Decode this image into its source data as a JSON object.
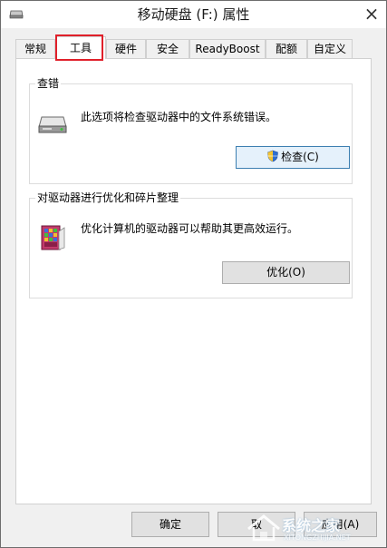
{
  "window": {
    "title": "移动硬盘 (F:) 属性",
    "close_glyph": "×"
  },
  "tabs": [
    {
      "label": "常规",
      "active": false
    },
    {
      "label": "工具",
      "active": true
    },
    {
      "label": "硬件",
      "active": false
    },
    {
      "label": "安全",
      "active": false
    },
    {
      "label": "ReadyBoost",
      "active": false
    },
    {
      "label": "配额",
      "active": false
    },
    {
      "label": "自定义",
      "active": false
    }
  ],
  "error_check": {
    "title": "查错",
    "description": "此选项将检查驱动器中的文件系统错误。",
    "button_label": "检查(C)",
    "icon": "drive-icon"
  },
  "optimize": {
    "title": "对驱动器进行优化和碎片整理",
    "description": "优化计算机的驱动器可以帮助其更高效运行。",
    "button_label": "优化(O)",
    "icon": "defrag-icon"
  },
  "footer": {
    "ok_label": "确定",
    "cancel_label": "取",
    "apply_label": "应用(A)"
  },
  "watermark": {
    "text": "系统之家",
    "sub": "XITONGZHIJIA.NET"
  },
  "colors": {
    "highlight_box": "#e0202a",
    "focus_border": "#3c7fb1"
  }
}
